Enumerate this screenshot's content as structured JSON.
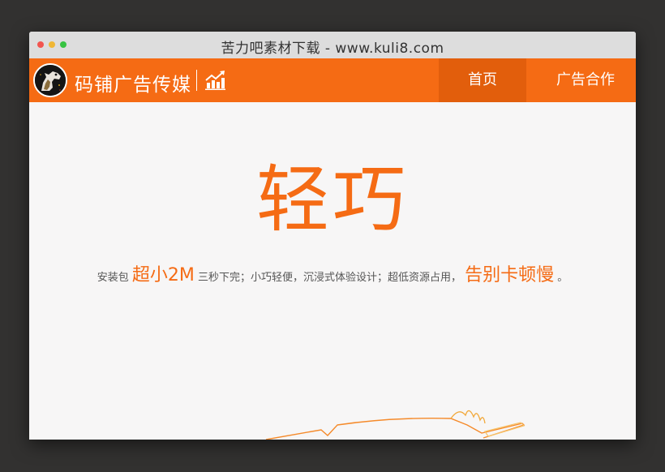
{
  "window": {
    "title": "苦力吧素材下载 - www.kuli8.com"
  },
  "navbar": {
    "brand": "码铺广告传媒",
    "items": [
      {
        "label": "首页",
        "active": true
      },
      {
        "label": "广告合作",
        "active": false
      }
    ]
  },
  "hero": {
    "title": "轻巧",
    "desc_parts": [
      {
        "text": "安装包",
        "highlight": false
      },
      {
        "text": "超小2M",
        "highlight": true
      },
      {
        "text": "三秒下完；小巧轻便，沉浸式体验设计；超低资源占用，",
        "highlight": false
      },
      {
        "text": "告别卡顿慢",
        "highlight": true
      },
      {
        "text": "。",
        "highlight": false
      }
    ]
  },
  "colors": {
    "accent": "#f56b14",
    "accent_dark": "#e25e0c",
    "background": "#f7f6f6",
    "desktop": "#323130"
  },
  "icons": {
    "logo": "horse-head-logo",
    "chart": "bar-chart-trend-icon"
  }
}
